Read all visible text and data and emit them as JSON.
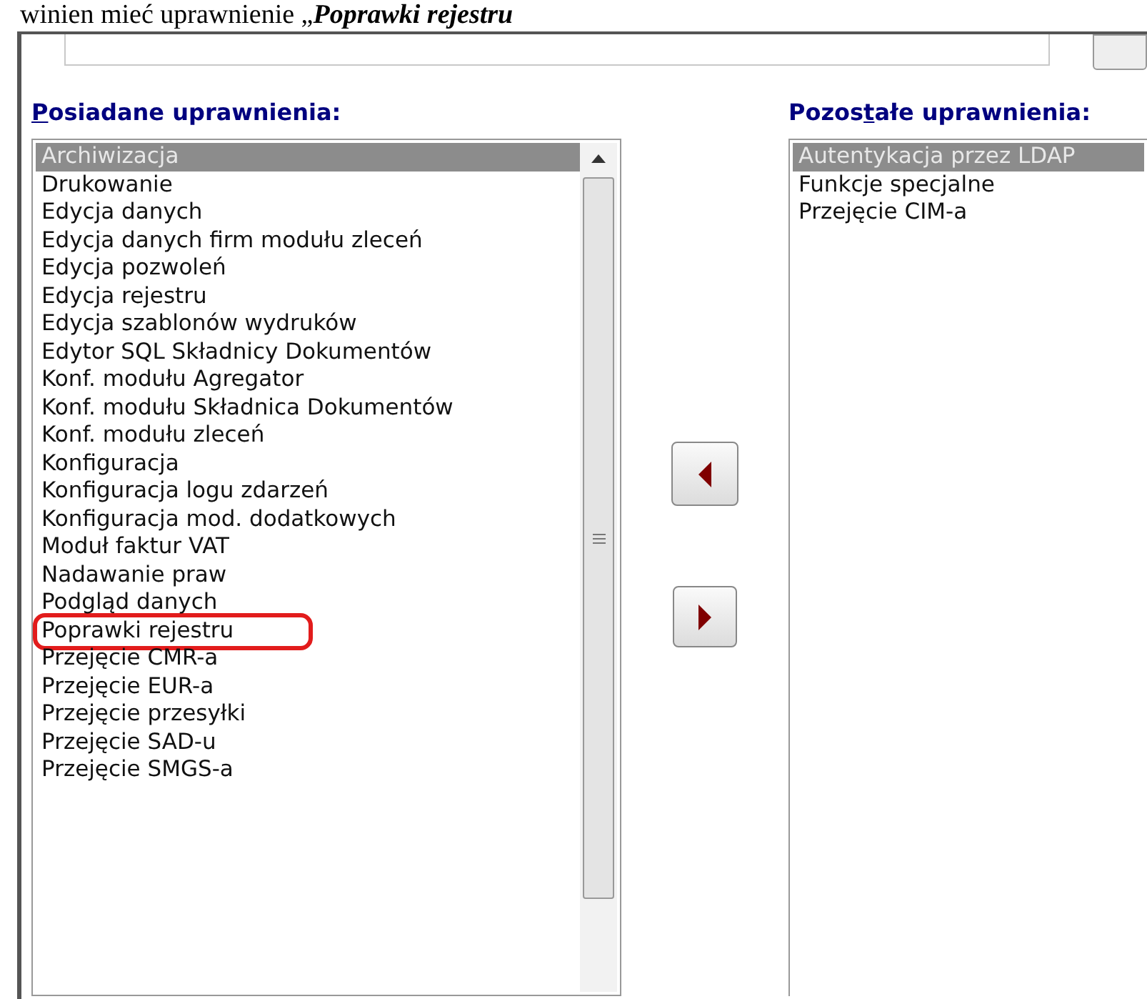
{
  "doc_line": {
    "text": "winien mieć uprawnienie „",
    "emphasis": "Poprawki rejestru"
  },
  "left_label": {
    "access_key": "P",
    "text_after": "osiadane uprawnienia:"
  },
  "right_label": {
    "text_before": "Pozos",
    "access_key": "t",
    "text_after": "ałe uprawnienia:"
  },
  "left_list": [
    {
      "label": "Archiwizacja",
      "selected": true,
      "highlighted": false
    },
    {
      "label": "Drukowanie",
      "selected": false,
      "highlighted": false
    },
    {
      "label": "Edycja danych",
      "selected": false,
      "highlighted": false
    },
    {
      "label": "Edycja danych firm modułu zleceń",
      "selected": false,
      "highlighted": false
    },
    {
      "label": "Edycja pozwoleń",
      "selected": false,
      "highlighted": false
    },
    {
      "label": "Edycja rejestru",
      "selected": false,
      "highlighted": false
    },
    {
      "label": "Edycja szablonów wydruków",
      "selected": false,
      "highlighted": false
    },
    {
      "label": "Edytor SQL Składnicy Dokumentów",
      "selected": false,
      "highlighted": false
    },
    {
      "label": "Konf. modułu Agregator",
      "selected": false,
      "highlighted": false
    },
    {
      "label": "Konf. modułu Składnica Dokumentów",
      "selected": false,
      "highlighted": false
    },
    {
      "label": "Konf. modułu zleceń",
      "selected": false,
      "highlighted": false
    },
    {
      "label": "Konfiguracja",
      "selected": false,
      "highlighted": false
    },
    {
      "label": "Konfiguracja logu zdarzeń",
      "selected": false,
      "highlighted": false
    },
    {
      "label": "Konfiguracja mod. dodatkowych",
      "selected": false,
      "highlighted": false
    },
    {
      "label": "Moduł faktur VAT",
      "selected": false,
      "highlighted": false
    },
    {
      "label": "Nadawanie praw",
      "selected": false,
      "highlighted": false
    },
    {
      "label": "Podgląd danych",
      "selected": false,
      "highlighted": false
    },
    {
      "label": "Poprawki rejestru",
      "selected": false,
      "highlighted": true
    },
    {
      "label": "Przejęcie CMR-a",
      "selected": false,
      "highlighted": false
    },
    {
      "label": "Przejęcie EUR-a",
      "selected": false,
      "highlighted": false
    },
    {
      "label": "Przejęcie przesyłki",
      "selected": false,
      "highlighted": false
    },
    {
      "label": "Przejęcie SAD-u",
      "selected": false,
      "highlighted": false
    },
    {
      "label": "Przejęcie SMGS-a",
      "selected": false,
      "highlighted": false
    }
  ],
  "right_list": [
    {
      "label": "Autentykacja przez LDAP",
      "selected": true
    },
    {
      "label": "Funkcje specjalne",
      "selected": false
    },
    {
      "label": "Przejęcie CIM-a",
      "selected": false
    }
  ]
}
